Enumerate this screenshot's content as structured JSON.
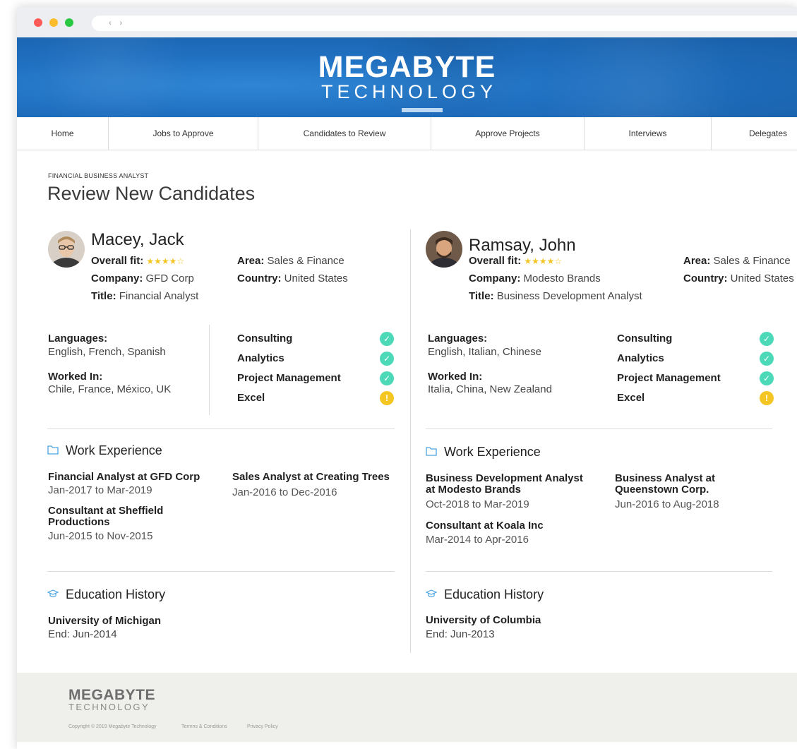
{
  "browser": {
    "nav_arrows": "‹ ›"
  },
  "brand": {
    "top": "MEGABYTE",
    "bottom": "TECHNOLOGY"
  },
  "nav": [
    "Home",
    "Jobs to Approve",
    "Candidates to Review",
    "Approve Projects",
    "Interviews",
    "Delegates"
  ],
  "page": {
    "subtitle": "FINANCIAL BUSINESS ANALYST",
    "title": "Review New Candidates"
  },
  "labels": {
    "overall_fit": "Overall fit:",
    "company": "Company:",
    "title": "Title:",
    "area": "Area:",
    "country": "Country:",
    "languages": "Languages:",
    "worked_in": "Worked In:",
    "work_experience": "Work Experience",
    "education_history": "Education History"
  },
  "candidates": [
    {
      "name": "Macey, Jack",
      "stars": "★★★★☆",
      "company": "GFD Corp",
      "title": "Financial Analyst",
      "area": "Sales & Finance",
      "country": "United States",
      "languages": "English, French, Spanish",
      "worked_in": "Chile, France, México, UK",
      "skills": [
        {
          "name": "Consulting",
          "status": "✓"
        },
        {
          "name": "Analytics",
          "status": "✓"
        },
        {
          "name": "Project Management",
          "status": "✓"
        },
        {
          "name": "Excel",
          "status": "!"
        }
      ],
      "experience": [
        {
          "title": "Financial Analyst at GFD Corp",
          "dates": "Jan-2017 to Mar-2019"
        },
        {
          "title": "Sales Analyst at Creating Trees",
          "dates": "Jan-2016 to Dec-2016"
        },
        {
          "title": "Consultant at Sheffield Productions",
          "dates": "Jun-2015 to Nov-2015"
        }
      ],
      "education": {
        "school": "University of Michigan",
        "end": "End: Jun-2014"
      }
    },
    {
      "name": "Ramsay, John",
      "stars": "★★★★☆",
      "company": "Modesto Brands",
      "title": "Business Development Analyst",
      "area": "Sales & Finance",
      "country": "United States",
      "languages": "English, Italian, Chinese",
      "worked_in": "Italia, China, New Zealand",
      "skills": [
        {
          "name": "Consulting",
          "status": "✓"
        },
        {
          "name": "Analytics",
          "status": "✓"
        },
        {
          "name": "Project Management",
          "status": "✓"
        },
        {
          "name": "Excel",
          "status": "!"
        }
      ],
      "experience": [
        {
          "title": "Business Development Analyst at Modesto Brands",
          "dates": "Oct-2018 to Mar-2019"
        },
        {
          "title": "Business Analyst at Queenstown Corp.",
          "dates": "Jun-2016 to Aug-2018"
        },
        {
          "title": "Consultant at Koala Inc",
          "dates": "Mar-2014 to Apr-2016"
        }
      ],
      "education": {
        "school": "University of Columbia",
        "end": "End: Jun-2013"
      }
    }
  ],
  "footer": {
    "logo_top": "MEGABYTE",
    "logo_bottom": "TECHNOLOGY",
    "copyright": "Copyright © 2019 Megabyte Technology",
    "terms": "Termns & Conditions",
    "privacy": "Privacy Policy"
  },
  "colors": {
    "brand_blue": "#1f6fc0",
    "ok": "#4cd9b8",
    "warn": "#f3c623",
    "star": "#f3c623"
  },
  "icons": {
    "work": "folder-icon",
    "education": "graduation-cap-icon"
  }
}
